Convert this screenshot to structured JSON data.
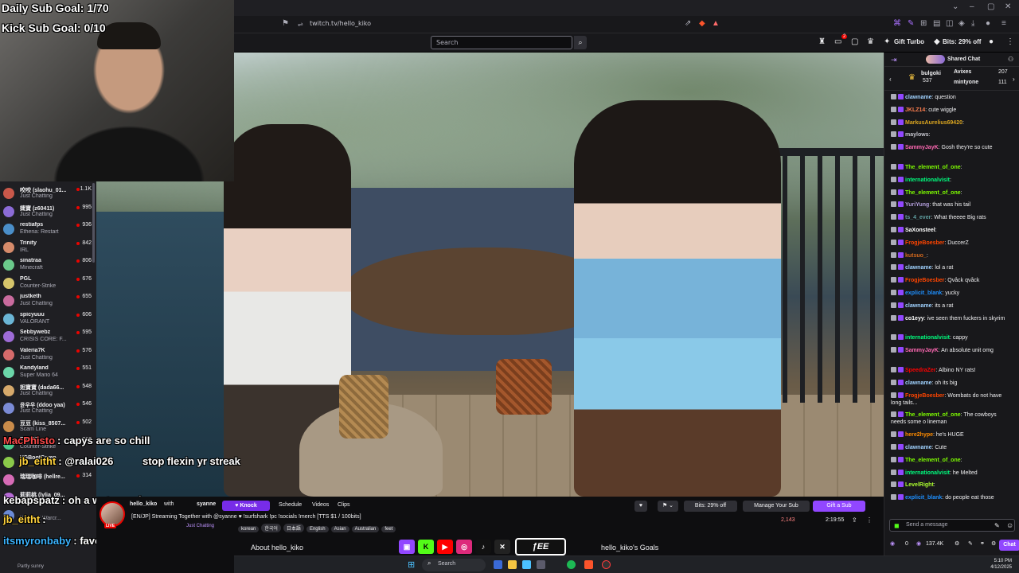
{
  "browser": {
    "url": "twitch.tv/hello_kiko"
  },
  "topnav": {
    "search_placeholder": "Search",
    "notifications_count": "2",
    "gift_turbo": "Gift Turbo",
    "bits_offer": "Bits: 29% off"
  },
  "overlay": {
    "daily_goal": "Daily Sub Goal: 1/70",
    "kick_goal": "Kick Sub Goal: 0/10",
    "messages": [
      {
        "user": "MacPhisto",
        "sep": ":",
        "text": "capys are so chill",
        "color": "#ff4b4b"
      },
      {
        "user": "jb_eitht",
        "sep": ":",
        "text": "@ralai026",
        "color": "#ffd23c"
      },
      {
        "user": "",
        "sep": "",
        "text": "stop flexin yr streak",
        "color": "#ffffff"
      },
      {
        "user": "kebapspatz",
        "sep": ":",
        "text": "oh a water god",
        "color": "#ffffff"
      },
      {
        "user": "jb_eitht",
        "sep": ":",
        "text": "",
        "color": "#ffd23c"
      },
      {
        "user": "itsmyronbaby",
        "sep": ":",
        "text": "favorite?",
        "color": "#3cb4ff"
      },
      {
        "user": "ヤロンド",
        "sep": ":",
        "text": "",
        "color": "#ffffff"
      }
    ]
  },
  "sidebar": {
    "channels": [
      {
        "name": "咬咬 (slaohu_01...",
        "category": "Just Chatting",
        "viewers": "1.1K",
        "color": "#c9584a"
      },
      {
        "name": "婕寶 (z60411)",
        "category": "Just Chatting",
        "viewers": "995",
        "color": "#8b6bd6"
      },
      {
        "name": "restiafps",
        "category": "Etheria: Restart",
        "viewers": "936",
        "color": "#4a8ec9"
      },
      {
        "name": "Trinity",
        "category": "IRL",
        "viewers": "842",
        "color": "#d68b6b"
      },
      {
        "name": "sinatraa",
        "category": "Minecraft",
        "viewers": "806",
        "color": "#6bc98b"
      },
      {
        "name": "PGL",
        "category": "Counter-Strike",
        "viewers": "676",
        "color": "#d6c56b"
      },
      {
        "name": "justketh",
        "category": "Just Chatting",
        "viewers": "655",
        "color": "#c96b9e"
      },
      {
        "name": "spicyuuu",
        "category": "VALORANT",
        "viewers": "606",
        "color": "#6bb6d6"
      },
      {
        "name": "Sebbywebz",
        "category": "CRISIS CORE: F...",
        "viewers": "595",
        "color": "#9e6bd6"
      },
      {
        "name": "Valeria7K",
        "category": "Just Chatting",
        "viewers": "576",
        "color": "#d66b6b"
      },
      {
        "name": "Kandyland",
        "category": "Super Mario 64",
        "viewers": "551",
        "color": "#6bd6a9"
      },
      {
        "name": "妲寶寶 (dada66...",
        "category": "Just Chatting",
        "viewers": "548",
        "color": "#d6a96b"
      },
      {
        "name": "윤우우 (ddoo yaa)",
        "category": "Just Chatting",
        "viewers": "546",
        "color": "#7b8bd6"
      },
      {
        "name": "豆豆 (kiss_8507...",
        "category": "Scam Line",
        "viewers": "502",
        "color": "#c98b4a"
      },
      {
        "name": "ESLCS",
        "category": "Counter-Strike",
        "viewers": "318",
        "color": "#4ac98b"
      },
      {
        "name": "VGBootCamp",
        "category": "",
        "viewers": "",
        "color": "#8bc94a"
      },
      {
        "name": "瑞瑞咖啡 (hellre...",
        "category": "",
        "viewers": "314",
        "color": "#d66bb6"
      },
      {
        "name": "莉莉桃 (lylia_09...",
        "category": "Just Chatting",
        "viewers": "",
        "color": "#b66bd6"
      },
      {
        "name": "",
        "category": "World of Warcr...",
        "viewers": "",
        "color": "#6b8bd6"
      }
    ]
  },
  "info": {
    "channel": "hello_kiko",
    "with_label": "with",
    "collab": "syanne",
    "knock_label": "Knock",
    "tabs": [
      "Schedule",
      "Videos",
      "Clips"
    ],
    "stream_title": "[EN/JP] Streaming Together with @syanne ♥ !surfshark !pc !socials !merch [TTS $1 / 100bits]",
    "category": "Just Chatting",
    "tags": [
      "korean",
      "한국어",
      "日本語",
      "English",
      "Asian",
      "Australian",
      "feet"
    ],
    "bits_offer": "Bits: 29% off",
    "manage_sub": "Manage Your Sub",
    "gift_sub": "Gift a Sub",
    "viewers": "2,143",
    "uptime": "2:19:55",
    "about": "About hello_kiko",
    "goals": "hello_kiko's Goals"
  },
  "chat": {
    "title": "Shared Chat",
    "leaderboard": [
      {
        "name": "bulgoki",
        "value": "537"
      },
      {
        "name": "Avixes",
        "value": "207"
      },
      {
        "name": "mintyone",
        "value": "111"
      }
    ],
    "messages": [
      {
        "user": "clawname",
        "text": "question",
        "color": "#a0d2ff"
      },
      {
        "user": "JKLZ14",
        "text": "cute wiggle",
        "color": "#ff7f50"
      },
      {
        "user": "MarkusAurelius69420",
        "text": "",
        "color": "#daa520"
      },
      {
        "user": "maylows",
        "text": "",
        "color": "#c8c8d0"
      },
      {
        "user": "SammyJayK",
        "text": "Gosh they're so cute",
        "color": "#ff69b4"
      },
      {
        "user": "The_element_of_one",
        "text": "",
        "color": "#7fff00"
      },
      {
        "user": "internationalvisit",
        "text": "",
        "color": "#00ff7f"
      },
      {
        "user": "The_element_of_one",
        "text": "",
        "color": "#7fff00"
      },
      {
        "user": "YuriYung",
        "text": "that was his tail",
        "color": "#b19cd9"
      },
      {
        "user": "ts_4_ever",
        "text": "What theeee Big rats",
        "color": "#5f9ea0"
      },
      {
        "user": "SaXonsteel",
        "text": "",
        "color": "#ffffff"
      },
      {
        "user": "FrogjeBoesber",
        "text": "DuccerZ",
        "color": "#ff4500"
      },
      {
        "user": "kutsuo_",
        "text": "",
        "color": "#d2691e"
      },
      {
        "user": "clawname",
        "text": "lol a rat",
        "color": "#a0d2ff"
      },
      {
        "user": "FrogjeBoesber",
        "text": "Qvåck qvåck",
        "color": "#ff4500"
      },
      {
        "user": "explicit_blank",
        "text": "yucky",
        "color": "#1e90ff"
      },
      {
        "user": "clawname",
        "text": "its a rat",
        "color": "#a0d2ff"
      },
      {
        "user": "co1eyy",
        "text": "ive seen them fuckers in skyrim",
        "color": "#ffffff"
      },
      {
        "user": "internationalvisit",
        "text": "cappy",
        "color": "#00ff7f"
      },
      {
        "user": "SammyJayK",
        "text": "An absolute unit omg",
        "color": "#ff69b4"
      },
      {
        "user": "SpeedraZer",
        "text": "Albino NY rats!",
        "color": "#ff0000"
      },
      {
        "user": "clawname",
        "text": "oh its big",
        "color": "#a0d2ff"
      },
      {
        "user": "FrogjeBoesber",
        "text": "Wombats do not have long tails...",
        "color": "#ff4500"
      },
      {
        "user": "The_element_of_one",
        "text": "The cowboys needs some o lineman",
        "color": "#7fff00"
      },
      {
        "user": "here2hype",
        "text": "he's HUGE",
        "color": "#ff8c00"
      },
      {
        "user": "clawname",
        "text": "Cute",
        "color": "#a0d2ff"
      },
      {
        "user": "The_element_of_one",
        "text": "",
        "color": "#7fff00"
      },
      {
        "user": "internationalvisit",
        "text": "he Melted",
        "color": "#00ff7f"
      },
      {
        "user": "LevelRight",
        "text": "",
        "color": "#adff2f"
      },
      {
        "user": "explicit_blank",
        "text": "do people eat those",
        "color": "#1e90ff"
      }
    ],
    "input_placeholder": "Send a message",
    "points": "0",
    "points_balance": "137.4K",
    "chat_button": "Chat"
  },
  "taskbar": {
    "search": "Search",
    "time": "5:10 PM",
    "date": "4/12/2025",
    "weather": "Partly sunny"
  },
  "colors": {
    "accent": "#9147ff",
    "live_red": "#eb0400",
    "background": "#0e0e10"
  }
}
